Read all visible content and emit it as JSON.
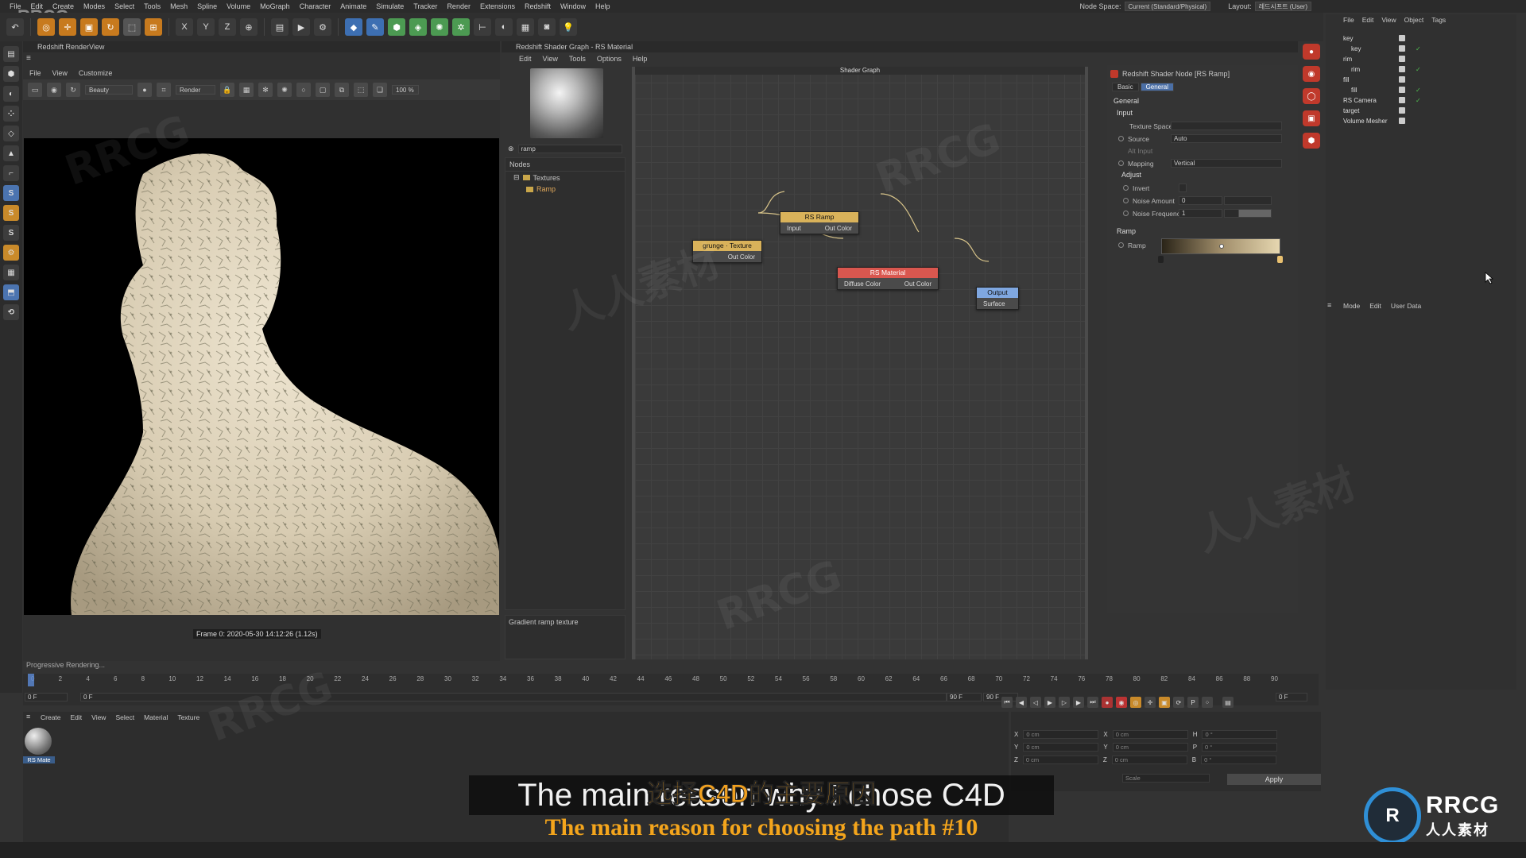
{
  "menubar": [
    "File",
    "Edit",
    "Create",
    "Modes",
    "Select",
    "Tools",
    "Mesh",
    "Spline",
    "Volume",
    "MoGraph",
    "Character",
    "Animate",
    "Simulate",
    "Tracker",
    "Render",
    "Extensions",
    "Redshift",
    "Window",
    "Help"
  ],
  "nodespace": {
    "label": "Node Space:",
    "value": "Current (Standard/Physical)",
    "layout_label": "Layout:",
    "layout_value": "레드시프트 (User)"
  },
  "toolbar_icons": [
    "undo-icon",
    "move-icon",
    "scale-icon",
    "rotate-icon",
    "live-select-icon",
    "last-tool-icon",
    "x-axis-icon",
    "y-axis-icon",
    "z-axis-icon",
    "coord-system-icon",
    "render-region-icon",
    "render-view-icon",
    "render-settings-icon",
    "cube-icon",
    "pen-icon",
    "generator-icon",
    "subdivision-icon",
    "deformer-icon",
    "mograph-icon",
    "floor-icon",
    "light-icon",
    "camera-icon",
    "environment-icon",
    "bulb-icon"
  ],
  "toolbar_axes": [
    "X",
    "Y",
    "Z"
  ],
  "renderview": {
    "title": "Redshift RenderView",
    "menu": [
      "File",
      "View",
      "Customize"
    ],
    "aov": "Beauty",
    "render_btn": "Render",
    "zoom": "100 %",
    "frame_info": "Frame 0: 2020-05-30 14:12:26 (1.12s)",
    "progress": "Progressive Rendering..."
  },
  "shadergraph": {
    "title": "Redshift Shader Graph - RS Material",
    "menu": [
      "Edit",
      "View",
      "Tools",
      "Options",
      "Help"
    ],
    "search": "ramp",
    "nodes_header": "Nodes",
    "tree": [
      "Textures",
      "Ramp"
    ],
    "description": "Gradient ramp texture",
    "canvas_title": "Shader Graph",
    "graph_nodes": {
      "rsramp": {
        "title": "RS Ramp",
        "in": "Input",
        "out": "Out Color"
      },
      "grunge": {
        "title": "grunge · Texture",
        "out": "Out Color"
      },
      "rsmat": {
        "title": "RS Material",
        "in": "Diffuse Color",
        "out": "Out Color"
      },
      "output": {
        "title": "Output",
        "in": "Surface"
      }
    },
    "colors": {
      "ramp_header": "#d9b25a",
      "grunge_header": "#d9b25a",
      "mat_header": "#d9574f",
      "out_header": "#7fa7e0"
    }
  },
  "attributes": {
    "title": "Redshift Shader Node [RS Ramp]",
    "tabs": [
      "Basic",
      "General"
    ],
    "section": "General",
    "input_group": "Input",
    "texture_space_label": "Texture Space",
    "source_label": "Source",
    "source_value": "Auto",
    "alt_input_label": "Alt Input",
    "mapping_label": "Mapping",
    "mapping_value": "Vertical",
    "adjust_group": "Adjust",
    "invert_label": "Invert",
    "noise_amount_label": "Noise Amount",
    "noise_amount_value": "0",
    "noise_freq_label": "Noise Frequency",
    "noise_freq_value": "1",
    "ramp_group": "Ramp",
    "ramp_label": "Ramp"
  },
  "objects": {
    "menu": [
      "File",
      "Edit",
      "View",
      "Object",
      "Tags"
    ],
    "items": [
      "key",
      "key",
      "rim",
      "rim",
      "fill",
      "fill",
      "RS Camera",
      "target",
      "Volume Mesher"
    ]
  },
  "attr_manager": {
    "menu": [
      "Mode",
      "Edit",
      "User Data"
    ]
  },
  "timeline": {
    "ticks": [
      "0",
      "2",
      "4",
      "6",
      "8",
      "10",
      "12",
      "14",
      "16",
      "18",
      "20",
      "22",
      "24",
      "26",
      "28",
      "30",
      "32",
      "34",
      "36",
      "38",
      "40",
      "42",
      "44",
      "46",
      "48",
      "50",
      "52",
      "54",
      "56",
      "58",
      "60",
      "62",
      "64",
      "66",
      "68",
      "70",
      "72",
      "74",
      "76",
      "78",
      "80",
      "82",
      "84",
      "86",
      "88",
      "90"
    ],
    "start": "0 F",
    "current": "0 F",
    "end": "90 F",
    "end2": "90 F",
    "right_frame": "0 F"
  },
  "material_mgr": {
    "menu": [
      "Create",
      "Edit",
      "View",
      "Select",
      "Material",
      "Texture"
    ],
    "material_name": "RS Mate"
  },
  "coords": {
    "rows": [
      [
        "X",
        "0 cm",
        "X",
        "0 cm",
        "H",
        "0 °"
      ],
      [
        "Y",
        "0 cm",
        "Y",
        "0 cm",
        "P",
        "0 °"
      ],
      [
        "Z",
        "0 cm",
        "Z",
        "0 cm",
        "B",
        "0 °"
      ]
    ],
    "scale": "Scale",
    "apply": "Apply"
  },
  "subtitles": {
    "en_line": "The main reason why I chose C4D",
    "cn_line": "选择C4D的主要原因",
    "en_bottom": "The main reason for choosing the path #10"
  },
  "brand": {
    "circle": "R",
    "name": "RRCG",
    "cn": "人人素材"
  },
  "watermark": "RRCG",
  "watermark_cn": "人人素材"
}
